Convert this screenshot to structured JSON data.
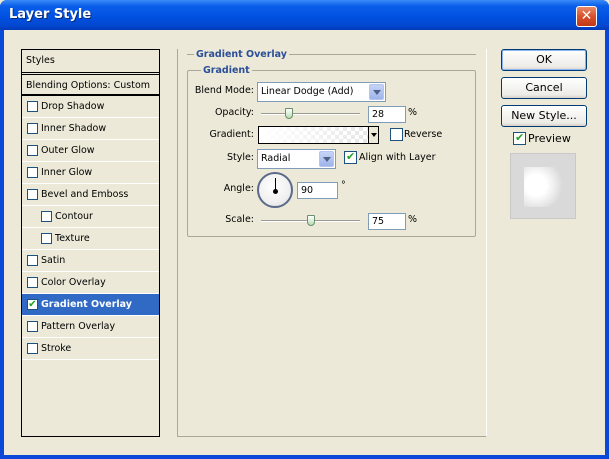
{
  "window": {
    "title": "Layer Style",
    "close_glyph": "✕"
  },
  "sidebar": {
    "header": "Styles",
    "blending": "Blending Options: Custom",
    "items": [
      {
        "label": "Drop Shadow",
        "checked": false
      },
      {
        "label": "Inner Shadow",
        "checked": false
      },
      {
        "label": "Outer Glow",
        "checked": false
      },
      {
        "label": "Inner Glow",
        "checked": false
      },
      {
        "label": "Bevel and Emboss",
        "checked": false
      },
      {
        "label": "Contour",
        "checked": false
      },
      {
        "label": "Texture",
        "checked": false
      },
      {
        "label": "Satin",
        "checked": false
      },
      {
        "label": "Color Overlay",
        "checked": false
      },
      {
        "label": "Gradient Overlay",
        "checked": true
      },
      {
        "label": "Pattern Overlay",
        "checked": false
      },
      {
        "label": "Stroke",
        "checked": false
      }
    ]
  },
  "panel": {
    "section_title": "Gradient Overlay",
    "group_title": "Gradient",
    "blend_mode": {
      "label": "Blend Mode:",
      "value": "Linear Dodge (Add)"
    },
    "opacity": {
      "label": "Opacity:",
      "value": "28",
      "unit": "%",
      "slider_percent": 28
    },
    "gradient": {
      "label": "Gradient:",
      "reverse_label": "Reverse",
      "reverse_checked": false
    },
    "style": {
      "label": "Style:",
      "value": "Radial",
      "align_label": "Align with Layer",
      "align_checked": true
    },
    "angle": {
      "label": "Angle:",
      "value": "90",
      "unit": "°",
      "degrees": 90
    },
    "scale": {
      "label": "Scale:",
      "value": "75",
      "unit": "%",
      "slider_percent": 50
    }
  },
  "buttons": {
    "ok": "OK",
    "cancel": "Cancel",
    "new_style": "New Style..."
  },
  "preview": {
    "label": "Preview",
    "checked": true
  },
  "colors": {
    "title_blue": "#0a5ee8",
    "section_blue": "#2a4e98",
    "selected_bg": "#316ac5",
    "check_green": "#21a121"
  }
}
